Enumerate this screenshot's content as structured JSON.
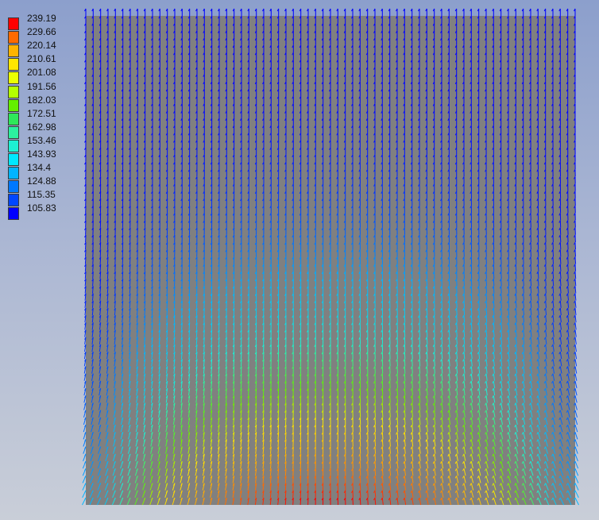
{
  "legend": {
    "labels": [
      "239.19",
      "229.66",
      "220.14",
      "210.61",
      "201.08",
      "191.56",
      "182.03",
      "172.51",
      "162.98",
      "153.46",
      "143.93",
      "134.4",
      "124.88",
      "115.35",
      "105.83"
    ],
    "colors": [
      "#ff0000",
      "#ff6a00",
      "#ffb400",
      "#ffe600",
      "#eaff00",
      "#b4ff00",
      "#64ef00",
      "#2ee85a",
      "#2cf0a0",
      "#1ef0d2",
      "#00e8ff",
      "#00b4ff",
      "#0078ff",
      "#0046ff",
      "#0000ff"
    ]
  },
  "field": {
    "background_color": "#808080",
    "vector_color_scale": [
      "#0000ff",
      "#00b4ff",
      "#1ef0d2",
      "#64ef00",
      "#ffe600",
      "#ffb400",
      "#ff6a00",
      "#ff0000"
    ]
  }
}
